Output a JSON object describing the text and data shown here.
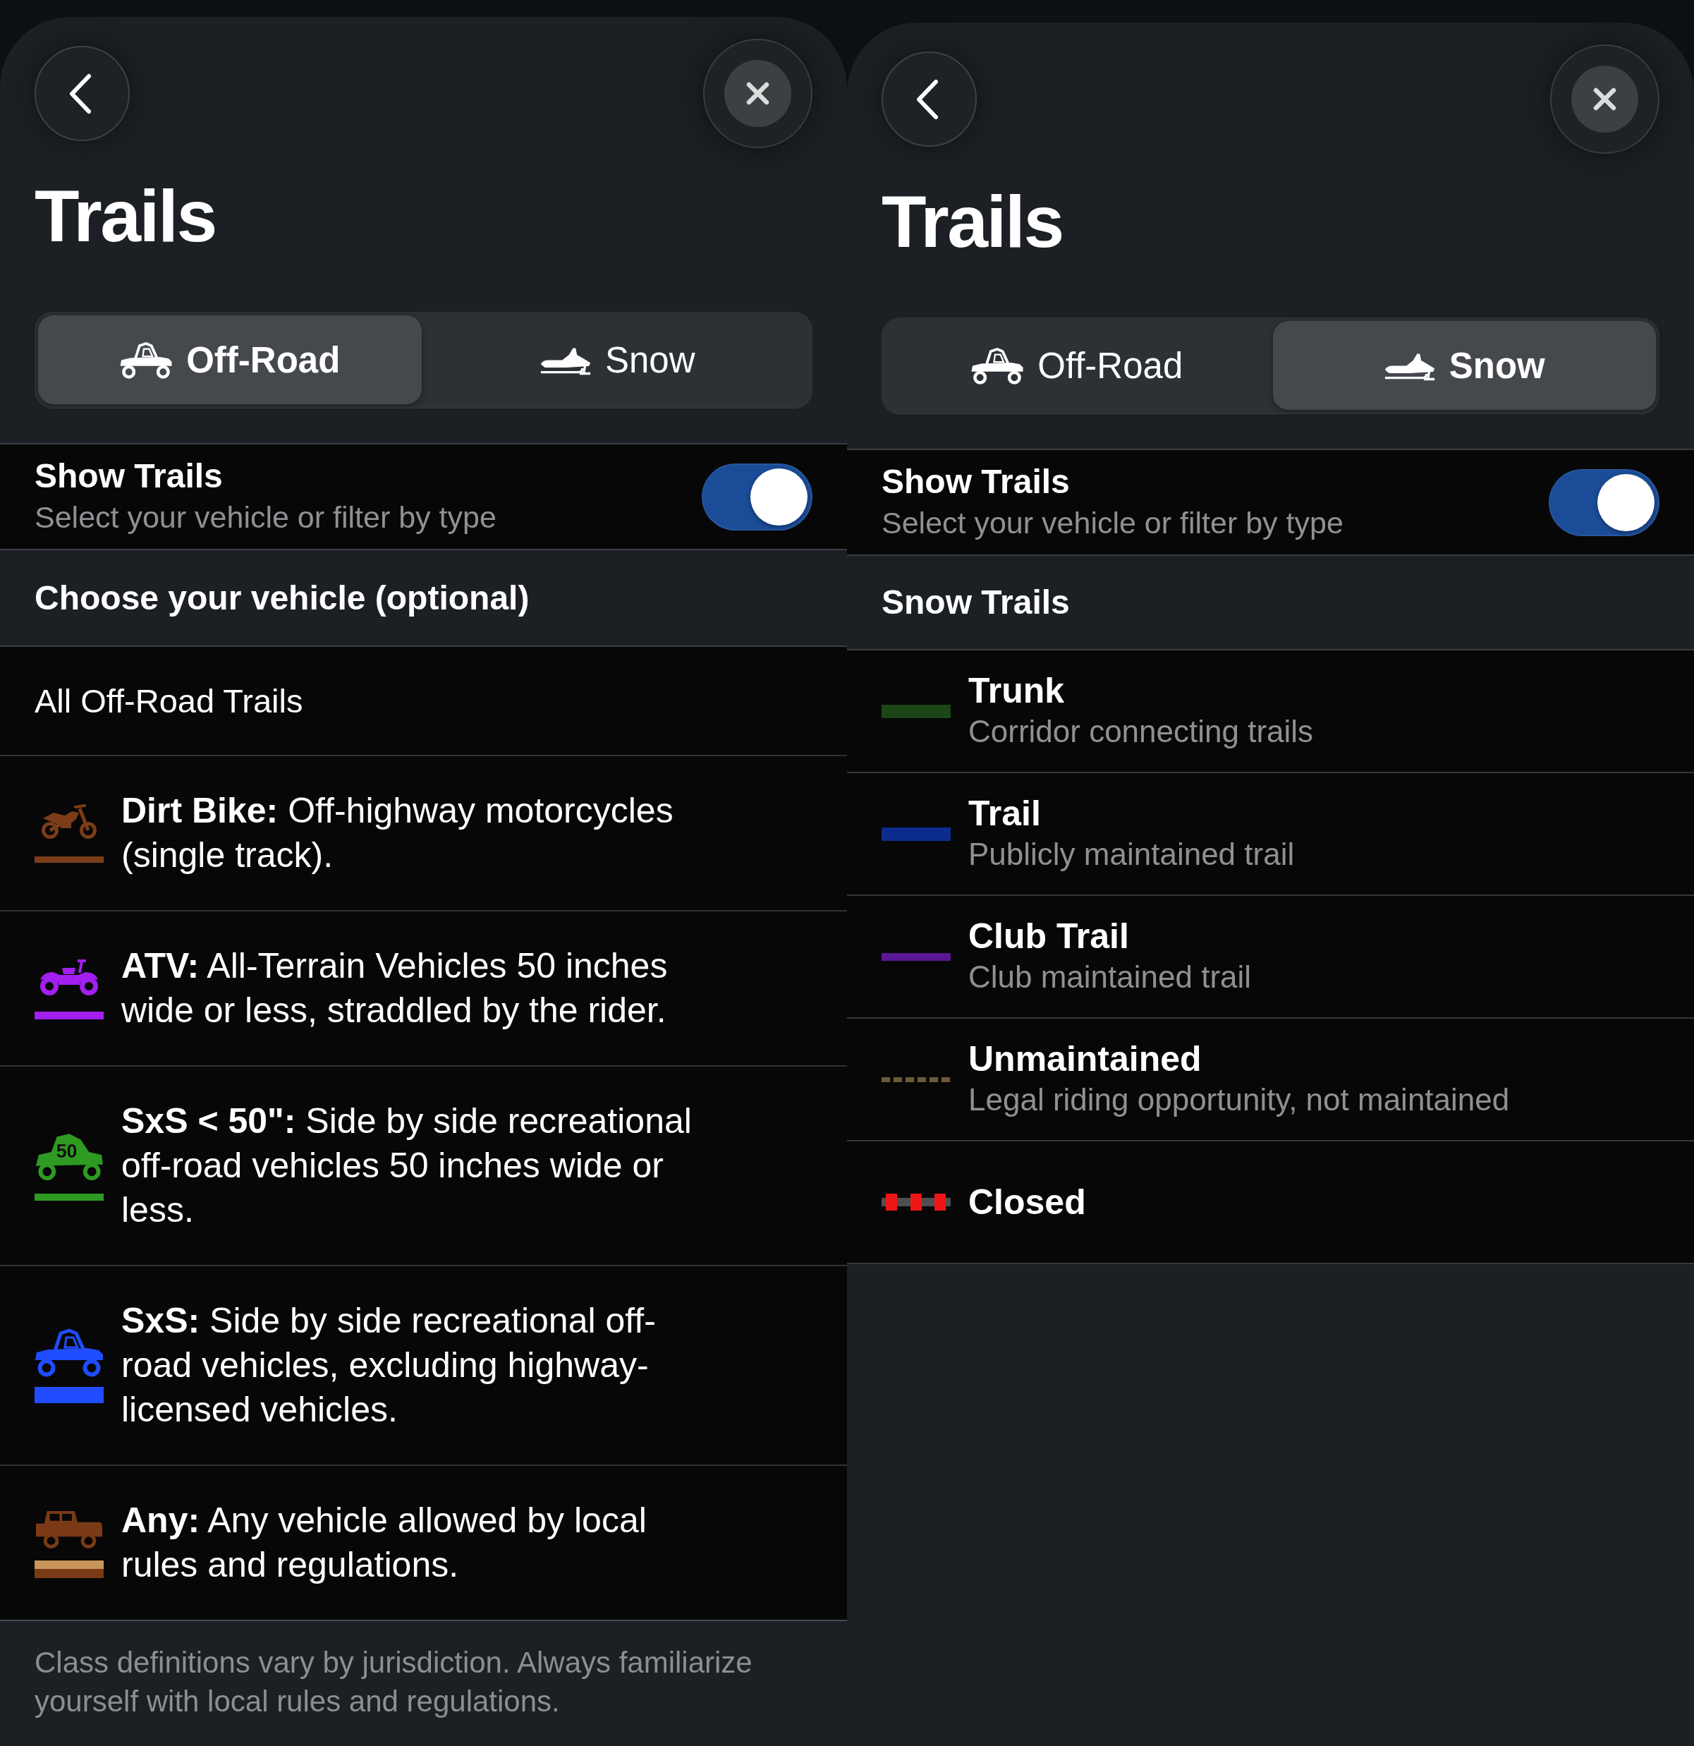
{
  "panels": [
    {
      "title": "Trails",
      "tabs": [
        {
          "label": "Off-Road",
          "kind": "offroad",
          "selected": true
        },
        {
          "label": "Snow",
          "kind": "snow",
          "selected": false
        }
      ],
      "show_trails": {
        "title": "Show Trails",
        "subtitle": "Select your vehicle or filter by type",
        "on": true
      },
      "section_title": "Choose your vehicle (optional)",
      "items": [
        {
          "kind": "all",
          "text": "All Off-Road Trails"
        },
        {
          "kind": "dirtbike",
          "color": "#7b3d17",
          "text": "**Dirt Bike:** Off-highway motorcycles (single track)."
        },
        {
          "kind": "atv",
          "color": "#a21ff0",
          "text": "**ATV:** All-Terrain Vehicles 50 inches wide or less, straddled by the rider."
        },
        {
          "kind": "sxs50",
          "color": "#2e9a22",
          "icon_label": "50",
          "text": "**SxS < 50\":** Side by side recreational off-road vehicles 50 inches wide or less."
        },
        {
          "kind": "sxs",
          "color": "#1f4dff",
          "text": "**SxS:** Side by side recreational off-road vehicles, excluding highway-licensed vehicles."
        },
        {
          "kind": "any",
          "color": "#7a3a16",
          "text": "**Any:** Any vehicle allowed by local rules and regulations."
        }
      ],
      "footer": "Class definitions vary by jurisdiction. Always familiarize yourself with local rules and regulations."
    },
    {
      "title": "Trails",
      "tabs": [
        {
          "label": "Off-Road",
          "kind": "offroad",
          "selected": false
        },
        {
          "label": "Snow",
          "kind": "snow",
          "selected": true
        }
      ],
      "show_trails": {
        "title": "Show Trails",
        "subtitle": "Select your vehicle or filter by type",
        "on": true
      },
      "section_title": "Snow Trails",
      "items": [
        {
          "kind": "solid",
          "color": "#1b4718",
          "name": "Trunk",
          "description": "Corridor connecting trails"
        },
        {
          "kind": "solid",
          "color": "#0d2c8f",
          "name": "Trail",
          "description": "Publicly maintained trail"
        },
        {
          "kind": "thin",
          "color": "#5a1896",
          "name": "Club Trail",
          "description": "Club maintained trail"
        },
        {
          "kind": "dashed",
          "color": "#6b5b36",
          "name": "Unmaintained",
          "description": "Legal riding opportunity, not maintained"
        },
        {
          "kind": "closed",
          "color": "#f01515",
          "name": "Closed"
        }
      ]
    }
  ]
}
